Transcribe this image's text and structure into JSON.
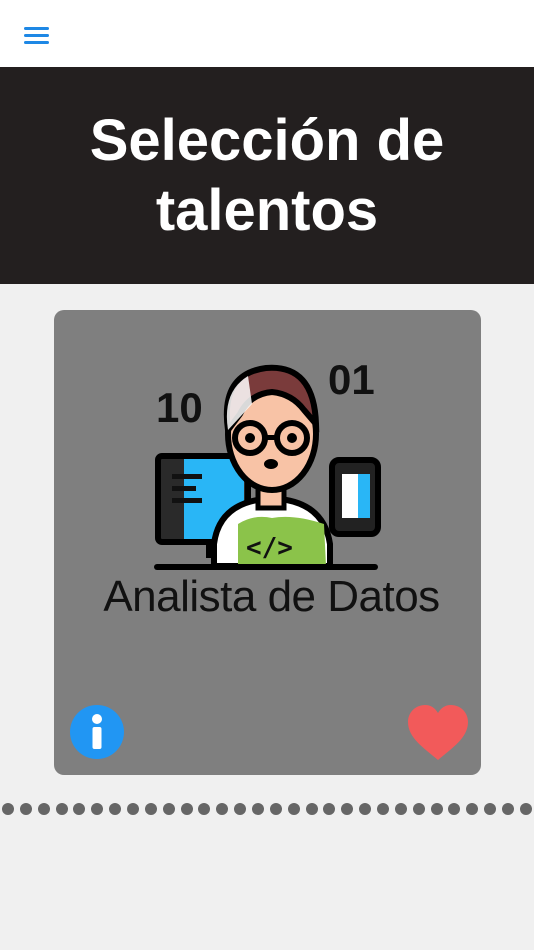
{
  "app": {
    "header_title": "Selección de talentos"
  },
  "card": {
    "title": "Analista de Datos",
    "badge_left": "10",
    "badge_right": "01"
  },
  "pagination": {
    "total": 30
  },
  "icons": {
    "menu": "hamburger-menu-icon",
    "info": "info-icon",
    "favorite": "heart-icon",
    "illustration": "developer-illustration"
  },
  "colors": {
    "accent": "#1e88e5",
    "header_bg": "#231f1f",
    "card_bg": "#7f7f7f",
    "heart": "#f25a5a",
    "info": "#2196f3"
  }
}
